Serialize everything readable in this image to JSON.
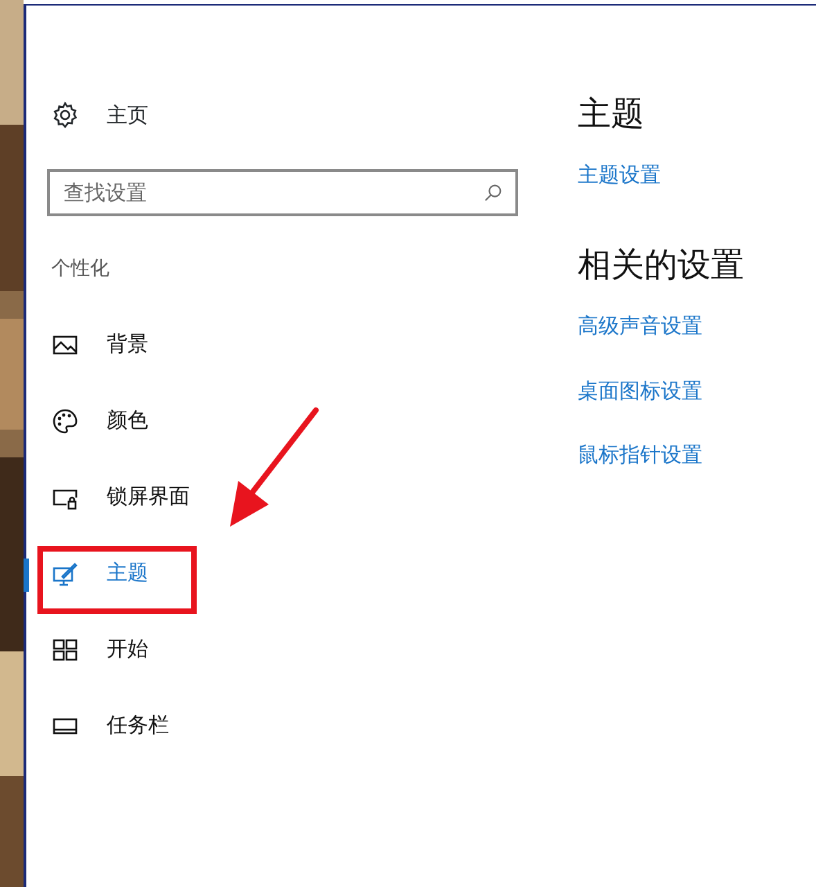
{
  "sidebar": {
    "home": {
      "label": "主页"
    },
    "search": {
      "placeholder": "查找设置"
    },
    "section": "个性化",
    "items": [
      {
        "kind": "background",
        "label": "背景",
        "selected": false,
        "highlighted": false
      },
      {
        "kind": "colors",
        "label": "颜色",
        "selected": false,
        "highlighted": false
      },
      {
        "kind": "lockscreen",
        "label": "锁屏界面",
        "selected": false,
        "highlighted": false
      },
      {
        "kind": "themes",
        "label": "主题",
        "selected": true,
        "highlighted": true
      },
      {
        "kind": "start",
        "label": "开始",
        "selected": false,
        "highlighted": false
      },
      {
        "kind": "taskbar",
        "label": "任务栏",
        "selected": false,
        "highlighted": false
      }
    ]
  },
  "content": {
    "sections": [
      {
        "heading": "主题",
        "links": [
          "主题设置"
        ]
      },
      {
        "heading": "相关的设置",
        "links": [
          "高级声音设置",
          "桌面图标设置",
          "鼠标指针设置"
        ]
      }
    ]
  }
}
